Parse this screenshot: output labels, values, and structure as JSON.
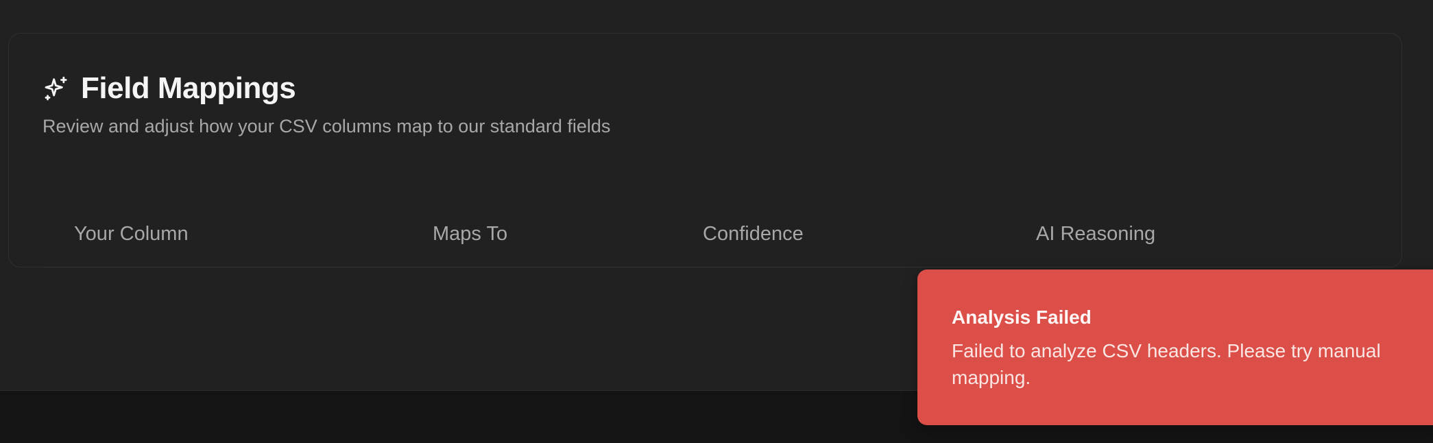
{
  "card": {
    "icon": "sparkles-icon",
    "title": "Field Mappings",
    "subtitle": "Review and adjust how your CSV columns map to our standard fields"
  },
  "table": {
    "columns": [
      "Your Column",
      "Maps To",
      "Confidence",
      "AI Reasoning"
    ]
  },
  "toast": {
    "title": "Analysis Failed",
    "message": "Failed to analyze CSV headers. Please try manual mapping.",
    "color": "#dc4f49"
  },
  "colors": {
    "background": "#212121",
    "footer": "#141414"
  }
}
